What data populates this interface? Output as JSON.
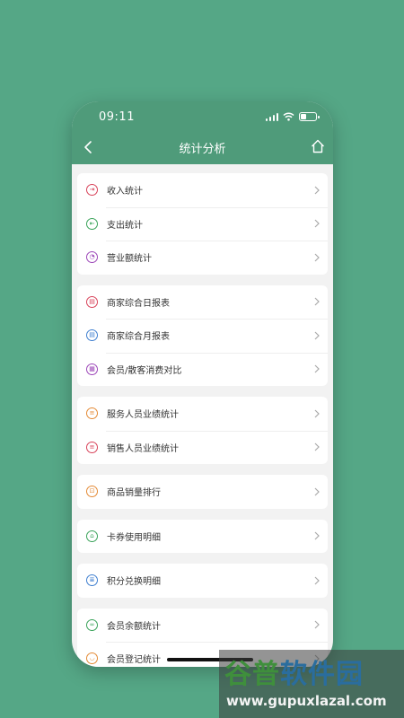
{
  "status": {
    "time": "09:11"
  },
  "nav": {
    "title": "统计分析"
  },
  "groups": [
    {
      "items": [
        {
          "label": "收入统计",
          "icon": "income-icon",
          "color": "#d8435a",
          "glyph": "⇥"
        },
        {
          "label": "支出统计",
          "icon": "expense-icon",
          "color": "#3aa35a",
          "glyph": "⇤"
        },
        {
          "label": "营业额统计",
          "icon": "turnover-icon",
          "color": "#9c46b8",
          "glyph": "◔"
        }
      ]
    },
    {
      "items": [
        {
          "label": "商家综合日报表",
          "icon": "daily-report-icon",
          "color": "#d8435a",
          "glyph": "▤"
        },
        {
          "label": "商家综合月报表",
          "icon": "monthly-report-icon",
          "color": "#3f7fd0",
          "glyph": "▤"
        },
        {
          "label": "会员/散客消费对比",
          "icon": "compare-icon",
          "color": "#9c46b8",
          "glyph": "▦"
        }
      ]
    },
    {
      "items": [
        {
          "label": "服务人员业绩统计",
          "icon": "service-staff-icon",
          "color": "#e48a35",
          "glyph": "≡"
        },
        {
          "label": "销售人员业绩统计",
          "icon": "sales-staff-icon",
          "color": "#d8435a",
          "glyph": "≡"
        }
      ]
    },
    {
      "items": [
        {
          "label": "商品销量排行",
          "icon": "cart-icon",
          "color": "#e48a35",
          "glyph": "⊡"
        }
      ]
    },
    {
      "items": [
        {
          "label": "卡券使用明细",
          "icon": "coupon-icon",
          "color": "#3aa35a",
          "glyph": "⌂"
        }
      ]
    },
    {
      "items": [
        {
          "label": "积分兑换明细",
          "icon": "points-icon",
          "color": "#3f7fd0",
          "glyph": "≣"
        }
      ]
    },
    {
      "items": [
        {
          "label": "会员余额统计",
          "icon": "balance-icon",
          "color": "#3aa35a",
          "glyph": "∞"
        },
        {
          "label": "会员登记统计",
          "icon": "member-register-icon",
          "color": "#e48a35",
          "glyph": "◡"
        }
      ]
    }
  ],
  "watermark": {
    "title": "谷普软件园",
    "url": "www.gupuxlazal.com"
  }
}
